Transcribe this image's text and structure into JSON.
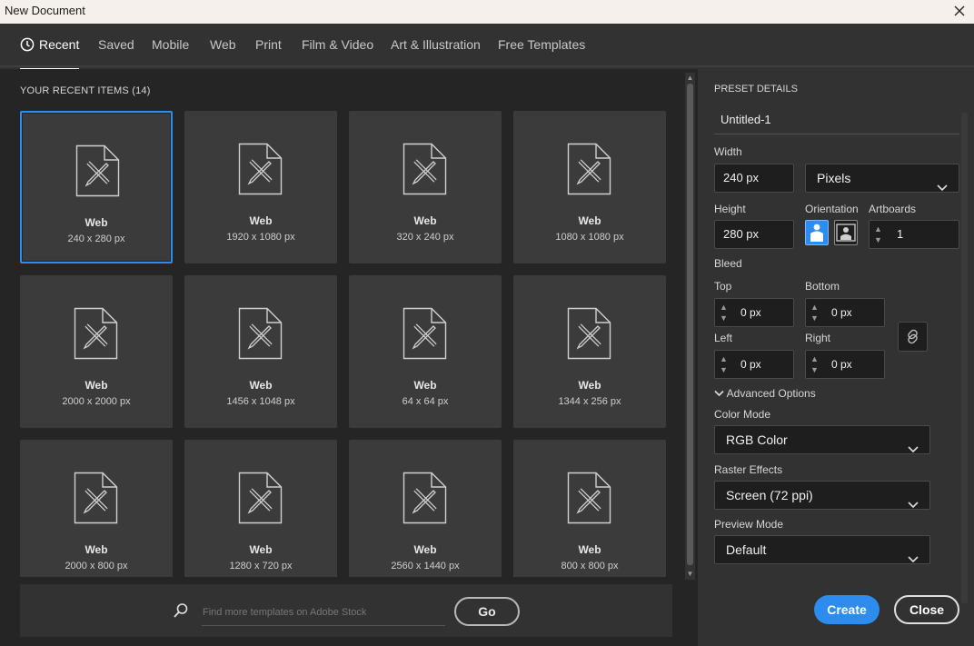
{
  "window": {
    "title": "New Document"
  },
  "tabs": [
    {
      "label": "Recent",
      "active": true
    },
    {
      "label": "Saved"
    },
    {
      "label": "Mobile"
    },
    {
      "label": "Web"
    },
    {
      "label": "Print"
    },
    {
      "label": "Film & Video"
    },
    {
      "label": "Art & Illustration"
    },
    {
      "label": "Free Templates"
    }
  ],
  "recent": {
    "heading": "YOUR RECENT ITEMS",
    "count": "(14)",
    "items": [
      {
        "name": "Web",
        "dims": "240 x 280 px",
        "selected": true
      },
      {
        "name": "Web",
        "dims": "1920 x 1080 px"
      },
      {
        "name": "Web",
        "dims": "320 x 240 px"
      },
      {
        "name": "Web",
        "dims": "1080 x 1080 px"
      },
      {
        "name": "Web",
        "dims": "2000 x 2000 px"
      },
      {
        "name": "Web",
        "dims": "1456 x 1048 px"
      },
      {
        "name": "Web",
        "dims": "64 x 64 px"
      },
      {
        "name": "Web",
        "dims": "1344 x 256 px"
      },
      {
        "name": "Web",
        "dims": "2000 x 800 px"
      },
      {
        "name": "Web",
        "dims": "1280 x 720 px"
      },
      {
        "name": "Web",
        "dims": "2560 x 1440 px"
      },
      {
        "name": "Web",
        "dims": "800 x 800 px"
      }
    ]
  },
  "search": {
    "placeholder": "Find more templates on Adobe Stock",
    "go_label": "Go"
  },
  "preset": {
    "heading": "PRESET DETAILS",
    "name": "Untitled-1",
    "width_label": "Width",
    "width_value": "240 px",
    "units": "Pixels",
    "height_label": "Height",
    "height_value": "280 px",
    "orientation_label": "Orientation",
    "artboards_label": "Artboards",
    "artboards_value": "1",
    "bleed_label": "Bleed",
    "top_label": "Top",
    "top_value": "0 px",
    "bottom_label": "Bottom",
    "bottom_value": "0 px",
    "left_label": "Left",
    "left_value": "0 px",
    "right_label": "Right",
    "right_value": "0 px",
    "advanced_label": "Advanced Options",
    "color_mode_label": "Color Mode",
    "color_mode_value": "RGB Color",
    "raster_label": "Raster Effects",
    "raster_value": "Screen (72 ppi)",
    "preview_label": "Preview Mode",
    "preview_value": "Default"
  },
  "actions": {
    "create_label": "Create",
    "close_label": "Close"
  },
  "colors": {
    "accent": "#2d8cf0",
    "panel": "#323232",
    "grid_bg": "#252525",
    "card": "#3b3b3b"
  }
}
